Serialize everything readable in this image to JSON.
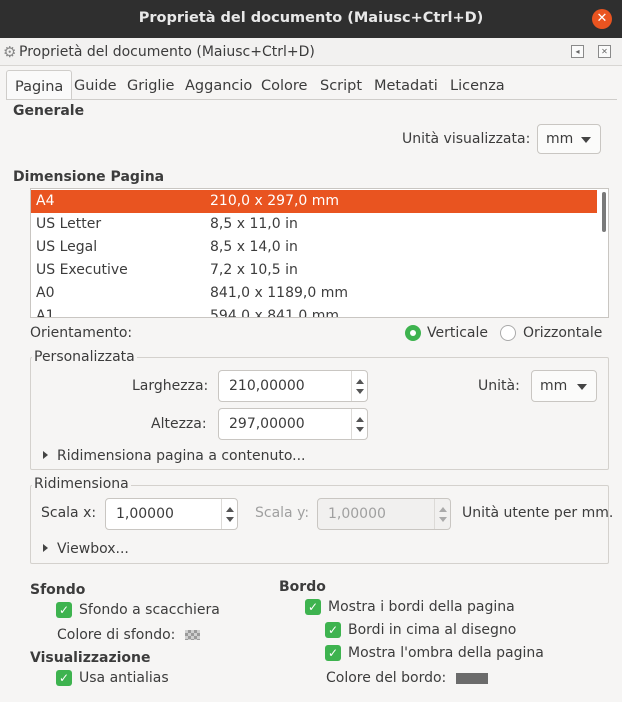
{
  "window": {
    "title": "Proprietà del documento (Maiusc+Ctrl+D)"
  },
  "dock": {
    "title": "Proprietà del documento (Maiusc+Ctrl+D)"
  },
  "tabs": [
    "Pagina",
    "Guide",
    "Griglie",
    "Aggancio",
    "Colore",
    "Script",
    "Metadati",
    "Licenza"
  ],
  "general": {
    "heading": "Generale",
    "display_units_label": "Unità visualizzata:",
    "display_units_value": "mm"
  },
  "page_size": {
    "heading": "Dimensione Pagina",
    "rows": [
      {
        "name": "A4",
        "size": "210,0 x 297,0 mm"
      },
      {
        "name": "US Letter",
        "size": "8,5 x 11,0 in"
      },
      {
        "name": "US Legal",
        "size": "8,5 x 14,0 in"
      },
      {
        "name": "US Executive",
        "size": "7,2 x 10,5 in"
      },
      {
        "name": "A0",
        "size": "841,0 x 1189,0 mm"
      },
      {
        "name": "A1",
        "size": "594,0 x 841,0 mm"
      }
    ],
    "selected": "A4"
  },
  "orientation": {
    "label": "Orientamento:",
    "portrait": "Verticale",
    "landscape": "Orizzontale",
    "selected": "Verticale"
  },
  "custom": {
    "legend": "Personalizzata",
    "width_label": "Larghezza:",
    "width_value": "210,00000",
    "height_label": "Altezza:",
    "height_value": "297,00000",
    "units_label": "Unità:",
    "units_value": "mm",
    "resize_expander": "Ridimensiona pagina a contenuto..."
  },
  "scale": {
    "legend": "Ridimensiona",
    "scale_x_label": "Scala x:",
    "scale_x_value": "1,00000",
    "scale_y_label": "Scala y:",
    "scale_y_value": "1,00000",
    "units_text": "Unità utente per mm.",
    "viewbox_expander": "Viewbox..."
  },
  "background": {
    "heading": "Sfondo",
    "checkerboard_label": "Sfondo a scacchiera",
    "checkerboard_checked": true,
    "color_label": "Colore di sfondo:"
  },
  "display": {
    "heading": "Visualizzazione",
    "antialias_label": "Usa antialias",
    "antialias_checked": true
  },
  "border": {
    "heading": "Bordo",
    "show_border_label": "Mostra i bordi della pagina",
    "show_border_checked": true,
    "border_on_top_label": "Bordi in cima al disegno",
    "border_on_top_checked": true,
    "shadow_label": "Mostra l'ombra della pagina",
    "shadow_checked": true,
    "color_label": "Colore del bordo:",
    "color": "#6b6b6b"
  },
  "colors": {
    "accent": "#e95420",
    "check": "#3eb34f",
    "titlebar": "#2f2f2f"
  }
}
